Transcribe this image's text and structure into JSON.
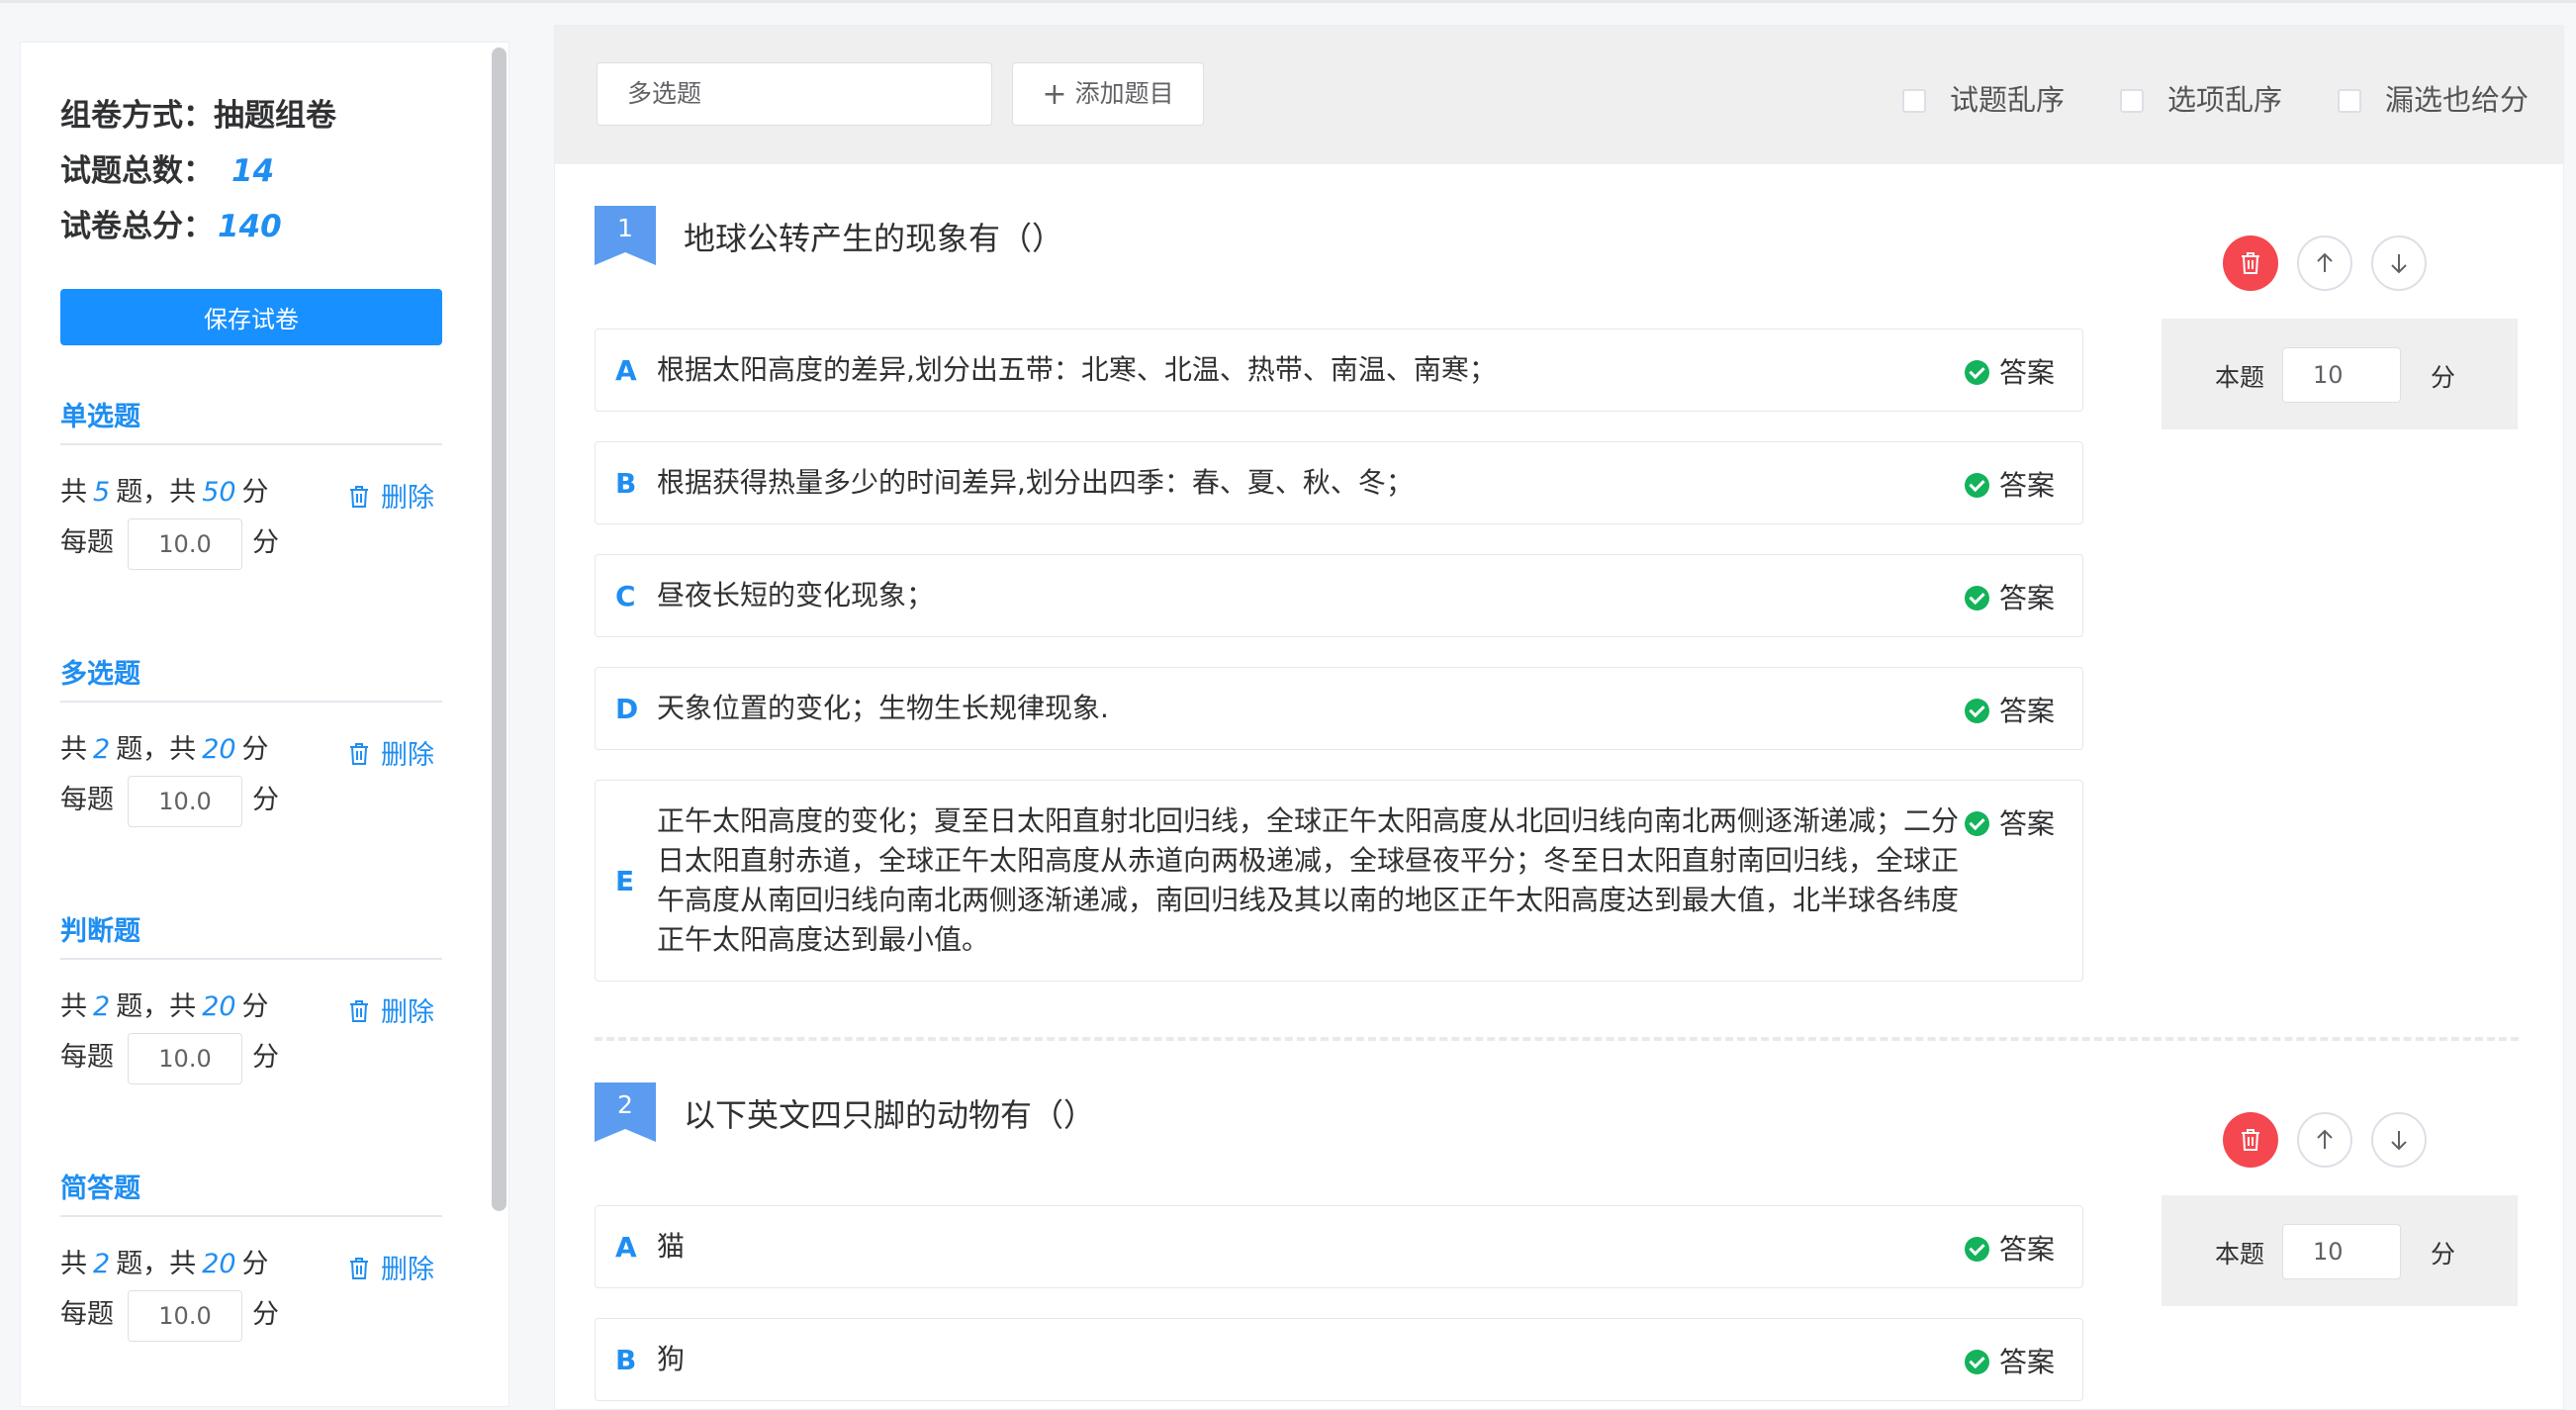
{
  "sidebar": {
    "mode_label": "组卷方式：",
    "mode_value": "抽题组卷",
    "total_count_label": "试题总数：",
    "total_count_value": "14",
    "total_score_label": "试卷总分：",
    "total_score_value": "140",
    "save_label": "保存试卷",
    "delete_label": "删除",
    "per_label": "每题",
    "unit": "分",
    "sections": [
      {
        "title": "单选题",
        "prefix": "共",
        "count": "5",
        "mid": "题，共",
        "score": "50",
        "suffix": "分",
        "per_value": "10.0"
      },
      {
        "title": "多选题",
        "prefix": "共",
        "count": "2",
        "mid": "题，共",
        "score": "20",
        "suffix": "分",
        "per_value": "10.0"
      },
      {
        "title": "判断题",
        "prefix": "共",
        "count": "2",
        "mid": "题，共",
        "score": "20",
        "suffix": "分",
        "per_value": "10.0"
      },
      {
        "title": "简答题",
        "prefix": "共",
        "count": "2",
        "mid": "题，共",
        "score": "20",
        "suffix": "分",
        "per_value": "10.0"
      }
    ]
  },
  "toolbar": {
    "type_select": "多选题",
    "add_label": "添加题目",
    "checkboxes": [
      "试题乱序",
      "选项乱序",
      "漏选也给分"
    ]
  },
  "answer_label": "答案",
  "score_label": "本题",
  "score_unit": "分",
  "questions": [
    {
      "number": "1",
      "title": "地球公转产生的现象有（）",
      "score": "10",
      "options": [
        {
          "letter": "A",
          "text": "根据太阳高度的差异,划分出五带：北寒、北温、热带、南温、南寒；"
        },
        {
          "letter": "B",
          "text": "根据获得热量多少的时间差异,划分出四季：春、夏、秋、冬；"
        },
        {
          "letter": "C",
          "text": "昼夜长短的变化现象；"
        },
        {
          "letter": "D",
          "text": "天象位置的变化；生物生长规律现象."
        },
        {
          "letter": "E",
          "text": "正午太阳高度的变化；夏至日太阳直射北回归线，全球正午太阳高度从北回归线向南北两侧逐渐递减；二分日太阳直射赤道，全球正午太阳高度从赤道向两极递减，全球昼夜平分；冬至日太阳直射南回归线，全球正午高度从南回归线向南北两侧逐渐递减，南回归线及其以南的地区正午太阳高度达到最大值，北半球各纬度正午太阳高度达到最小值。"
        }
      ]
    },
    {
      "number": "2",
      "title": "以下英文四只脚的动物有（）",
      "score": "10",
      "options": [
        {
          "letter": "A",
          "text": "猫"
        },
        {
          "letter": "B",
          "text": "狗"
        }
      ]
    }
  ],
  "colors": {
    "accent": "#1890ff",
    "danger": "#f5474f",
    "success": "#13b25b",
    "badge": "#5b9cf0"
  }
}
